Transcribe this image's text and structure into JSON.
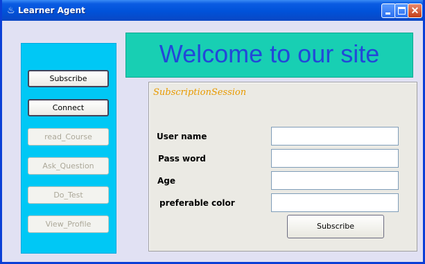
{
  "window": {
    "title": "Learner Agent",
    "icon": "java-cup-icon"
  },
  "sidebar": {
    "buttons": [
      {
        "label": "Subscribe",
        "enabled": true
      },
      {
        "label": "Connect",
        "enabled": true
      },
      {
        "label": "read_Course",
        "enabled": false
      },
      {
        "label": "Ask_Question",
        "enabled": false
      },
      {
        "label": "Do_Test",
        "enabled": false
      },
      {
        "label": "View_Profile",
        "enabled": false
      }
    ]
  },
  "banner": {
    "text": "Welcome to our site"
  },
  "form": {
    "title": "SubscriptionSession",
    "fields": [
      {
        "label": "User name",
        "value": ""
      },
      {
        "label": "Pass word",
        "value": ""
      },
      {
        "label": "Age",
        "value": ""
      },
      {
        "label": "preferable color",
        "value": ""
      }
    ],
    "submit_label": "Subscribe"
  },
  "colors": {
    "sidebar": "#00c8f5",
    "banner": "#18cfb3",
    "banner_text": "#2248d8",
    "session_title": "#e89a00",
    "titlebar": "#0052d9"
  }
}
